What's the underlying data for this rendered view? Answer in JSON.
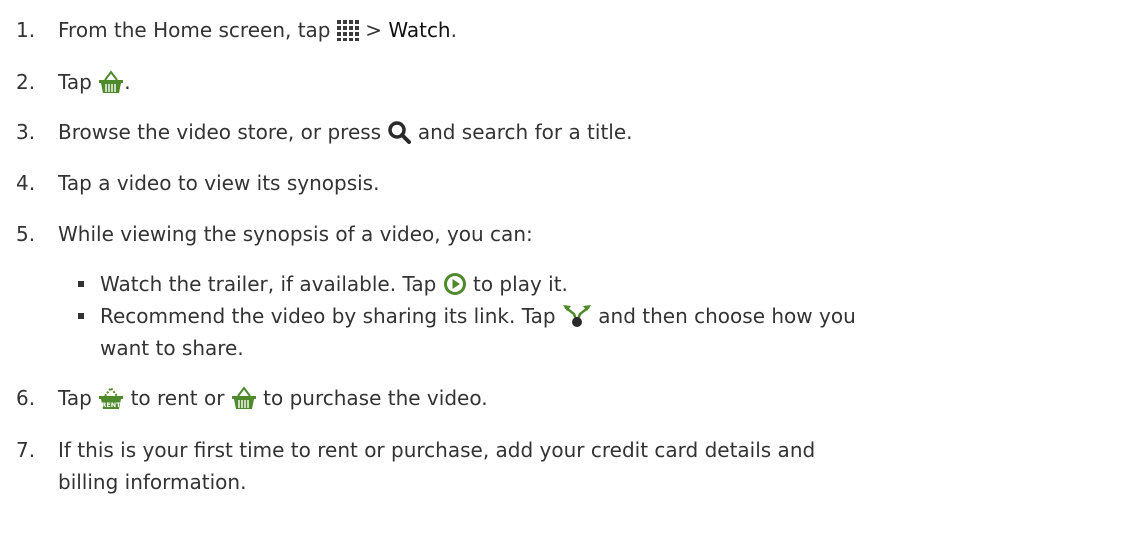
{
  "steps": [
    {
      "num": "1.",
      "before": "From the Home screen, tap",
      "icon": "apps-grid-icon",
      "after_sep": ">",
      "bold": "Watch",
      "end": "."
    },
    {
      "num": "2.",
      "before": "Tap",
      "icon": "store-basket-icon",
      "end": "."
    },
    {
      "num": "3.",
      "before": "Browse the video store, or press",
      "icon": "search-icon",
      "after": "and search for a title."
    },
    {
      "num": "4.",
      "text": "Tap a video to view its synopsis."
    },
    {
      "num": "5.",
      "text": "While viewing the synopsis of a video, you can:"
    },
    {
      "num": "6.",
      "before": "Tap",
      "icon": "rent-icon",
      "icon_label": "RENT",
      "mid": "to rent or",
      "icon2": "store-basket-icon",
      "after": "to purchase the video."
    },
    {
      "num": "7.",
      "line1": "If this is your first time to rent or purchase, add your credit card details and",
      "line2": "billing information."
    }
  ],
  "bullets": [
    {
      "before": "Watch the trailer, if available. Tap",
      "icon": "play-circle-icon",
      "after": "to play it."
    },
    {
      "before": "Recommend the video by sharing its link. Tap",
      "icon": "share-icon",
      "after": "and then choose how you",
      "line2": "want to share."
    }
  ],
  "colors": {
    "text": "#333333",
    "icon_green": "#4e8a2c",
    "icon_dark": "#3a3a3a"
  }
}
